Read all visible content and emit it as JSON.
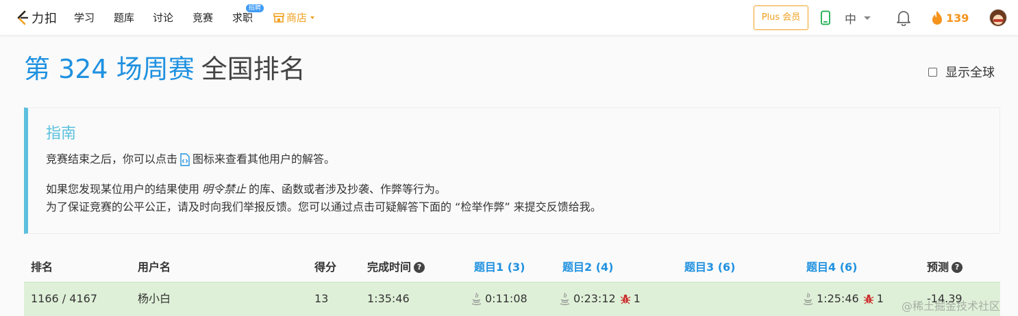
{
  "nav": {
    "logo_text": "力扣",
    "items": [
      "学习",
      "题库",
      "讨论",
      "竞赛",
      "求职"
    ],
    "badge": "招聘",
    "shop": "商店",
    "plus_button": "Plus 会员",
    "language": "中",
    "streak": "139"
  },
  "title": {
    "contest": "第 324 场周赛",
    "subtitle": "全国排名"
  },
  "global_toggle": "显示全球",
  "guide": {
    "title": "指南",
    "line1_a": "竞赛结束之后，你可以点击",
    "line1_b": "图标来查看其他用户的解答。",
    "line2_a": "如果您发现某位用户的结果使用",
    "line2_em": "明令禁止",
    "line2_b": "的库、函数或者涉及抄袭、作弊等行为。",
    "line3": "为了保证竞赛的公平公正，请及时向我们举报反馈。您可以通过点击可疑解答下面的 “检举作弊” 来提交反馈给我。"
  },
  "table": {
    "headers": {
      "rank": "排名",
      "username": "用户名",
      "score": "得分",
      "finish_time": "完成时间",
      "q1": "题目1 (3)",
      "q2": "题目2 (4)",
      "q3": "题目3 (6)",
      "q4": "题目4 (6)",
      "predict": "预测"
    },
    "row": {
      "rank": "1166 / 4167",
      "username": "杨小白",
      "score": "13",
      "finish_time": "1:35:46",
      "q1_time": "0:11:08",
      "q2_time": "0:23:12",
      "q2_bugs": "1",
      "q4_time": "1:25:46",
      "q4_bugs": "1",
      "predict": "-14.39"
    }
  },
  "watermark": "@稀土掘金技术社区",
  "colors": {
    "accent_blue": "#1f91e0",
    "guide_blue": "#5bc0de",
    "orange": "#f0a020",
    "row_green": "#dff0d8",
    "bug_red": "#c9302c"
  }
}
